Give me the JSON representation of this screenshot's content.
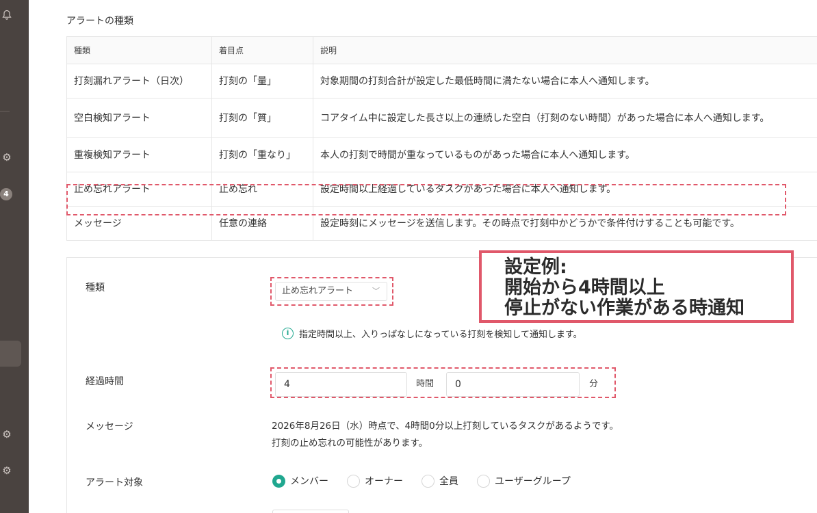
{
  "sidebar": {
    "badge": "4"
  },
  "section": {
    "title": "アラートの種類"
  },
  "table": {
    "headers": [
      "種類",
      "着目点",
      "説明"
    ],
    "rows": [
      [
        "打刻漏れアラート（日次）",
        "打刻の「量」",
        "対象期間の打刻合計が設定した最低時間に満たない場合に本人へ通知します。"
      ],
      [
        "空白検知アラート",
        "打刻の「質」",
        "コアタイム中に設定した長さ以上の連続した空白（打刻のない時間）があった場合に本人へ通知します。"
      ],
      [
        "重複検知アラート",
        "打刻の「重なり」",
        "本人の打刻で時間が重なっているものがあった場合に本人へ通知します。"
      ],
      [
        "止め忘れアラート",
        "止め忘れ",
        "設定時間以上経過しているタスクがあった場合に本人へ通知します。"
      ],
      [
        "メッセージ",
        "任意の連絡",
        "設定時刻にメッセージを送信します。その時点で打刻中かどうかで条件付けすることも可能です。"
      ]
    ]
  },
  "form": {
    "type_label": "種類",
    "type_value": "止め忘れアラート",
    "info_text": "指定時間以上、入りっぱなしになっている打刻を検知して通知します。",
    "elapsed_label": "経過時間",
    "hours_value": "4",
    "hours_unit": "時間",
    "minutes_value": "0",
    "minutes_unit": "分",
    "message_label": "メッセージ",
    "message_line1": "2026年8月26日（水）時点で、4時間0分以上打刻しているタスクがあるようです。",
    "message_line2": "打刻の止め忘れの可能性があります。",
    "target_label": "アラート対象",
    "target_options": [
      "メンバー",
      "オーナー",
      "全員",
      "ユーザーグループ"
    ],
    "target_selected": "メンバー"
  },
  "callout": {
    "line1": "設定例:",
    "line2": "開始から4時間以上",
    "line3": "停止がない作業がある時通知"
  },
  "colors": {
    "sidebar": "#4a4340",
    "accent": "#20a78f",
    "highlight": "#e0586a"
  }
}
